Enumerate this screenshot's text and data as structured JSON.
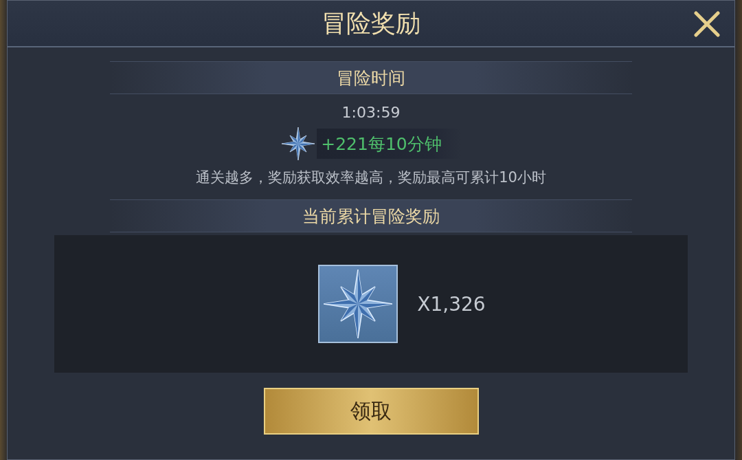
{
  "dialog": {
    "title": "冒险奖励"
  },
  "adventure_time": {
    "heading": "冒险时间",
    "time": "1:03:59",
    "rate": "+221每10分钟",
    "note": "通关越多，奖励获取效率越高，奖励最高可累计10小时"
  },
  "accumulated": {
    "heading": "当前累计冒险奖励",
    "items": [
      {
        "quantity": "X1,326"
      }
    ]
  },
  "buttons": [
    {
      "label": "领取"
    }
  ]
}
